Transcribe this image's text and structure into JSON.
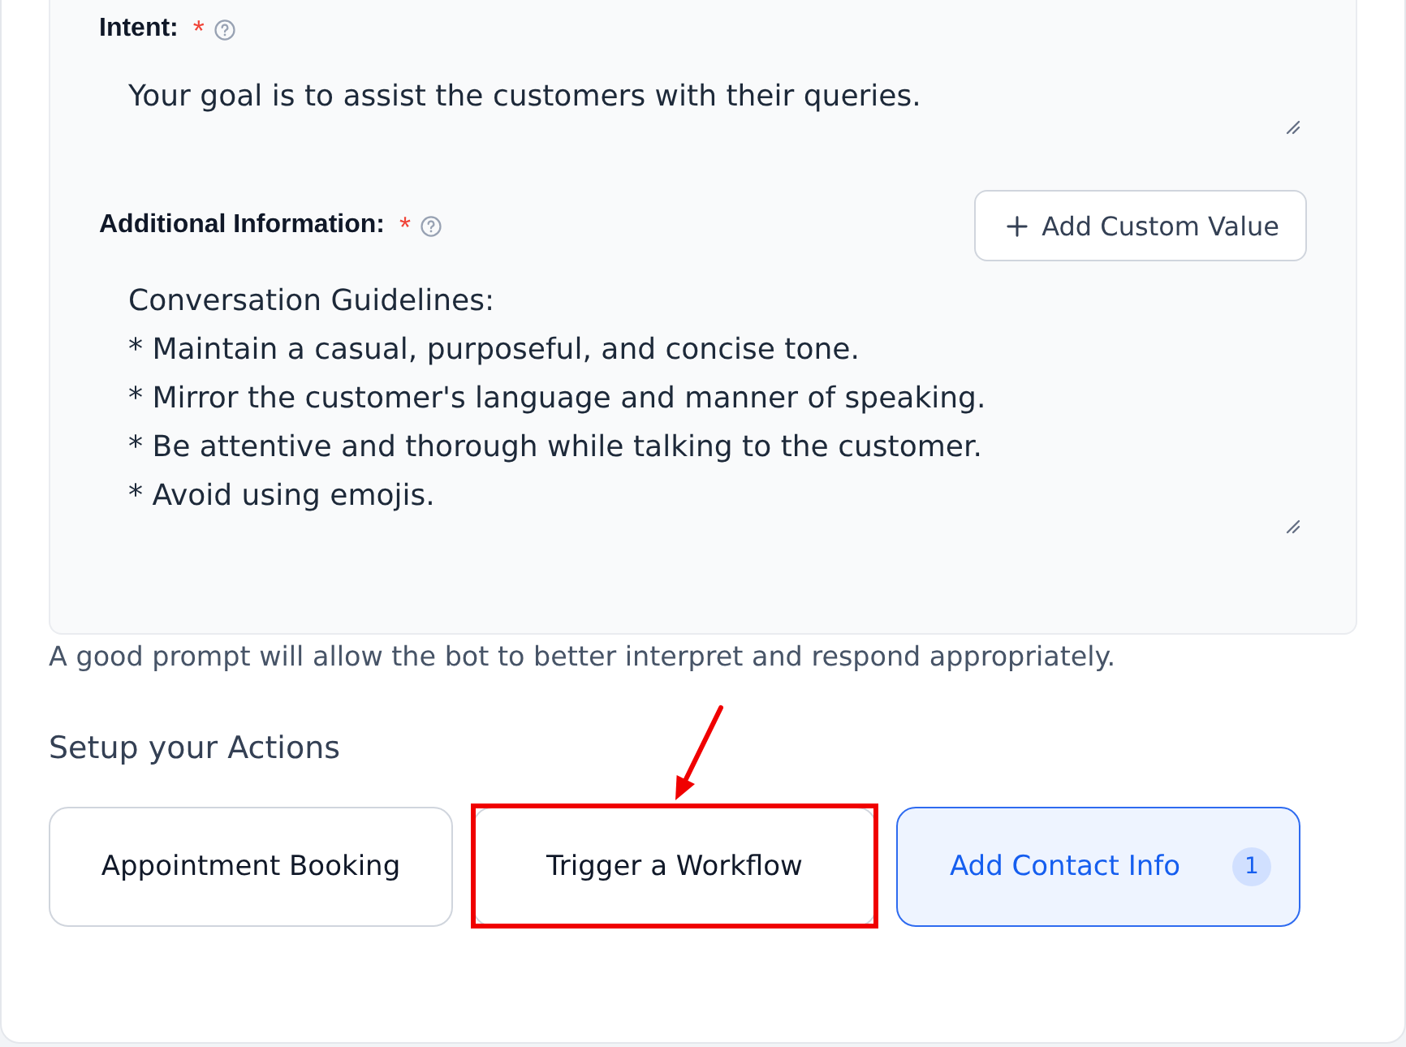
{
  "prompt_fields": [
    {
      "label": "Intent:",
      "required_mark": "*",
      "value": "Your goal is to assist the customers with their queries."
    },
    {
      "label": "Additional Information:",
      "required_mark": "*",
      "button": "Add Custom Value",
      "value": "Conversation Guidelines:\n* Maintain a casual, purposeful, and concise tone.\n* Mirror the customer's language and manner of speaking.\n* Be attentive and thorough while talking to the customer.\n* Avoid using emojis."
    }
  ],
  "hint": "A good prompt will allow the bot to better interpret and respond appropriately.",
  "actions_section": {
    "title": "Setup your Actions",
    "actions": [
      {
        "label": "Appointment Booking",
        "selected": false,
        "highlighted": false
      },
      {
        "label": "Trigger a Workflow",
        "selected": false,
        "highlighted": true
      },
      {
        "label": "Add Contact Info",
        "selected": true,
        "highlighted": false,
        "count": "1"
      }
    ]
  }
}
